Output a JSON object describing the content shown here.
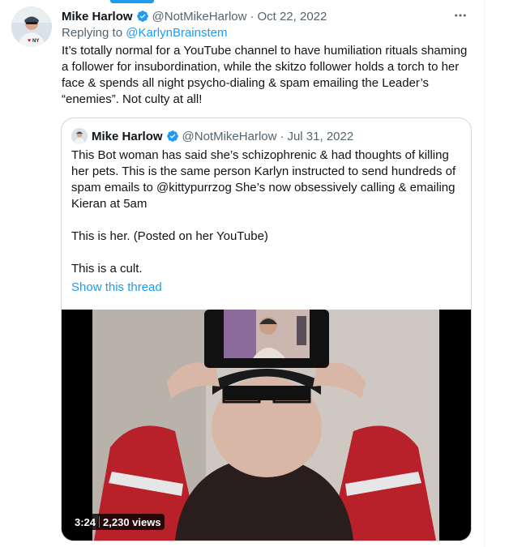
{
  "tweet": {
    "name": "Mike Harlow",
    "handle": "@NotMikeHarlow",
    "separator": "·",
    "date": "Oct 22, 2022",
    "more_icon": "more-horizontal-icon",
    "reply_prefix": "Replying to ",
    "reply_to": "@KarlynBrainstem",
    "text": "It’s totally normal for a YouTube channel to have humiliation rituals shaming\na follower for insubordination, while the skitzo follower holds a torch to her\nface & spends all night psycho-dialing & spam emailing the Leader’s\n“enemies”. Not culty at all!"
  },
  "quote": {
    "name": "Mike Harlow",
    "handle": "@NotMikeHarlow",
    "separator": "·",
    "date": "Jul 31, 2022",
    "text": "This Bot woman has said she’s schizophrenic & had thoughts of killing\nher pets. This is the same person Karlyn instructed to send hundreds of\nspam emails to @kittypurrzog She’s now obsessively calling & emailing\nKieran at 5am\n\nThis is her. (Posted on her YouTube)\n\nThis is a cult.",
    "show_thread": "Show this thread",
    "video": {
      "duration": "3:24",
      "views": "2,230 views"
    }
  },
  "colors": {
    "accent": "#1d9bf0",
    "secondary_text": "#536471",
    "border": "#cfd9de"
  }
}
